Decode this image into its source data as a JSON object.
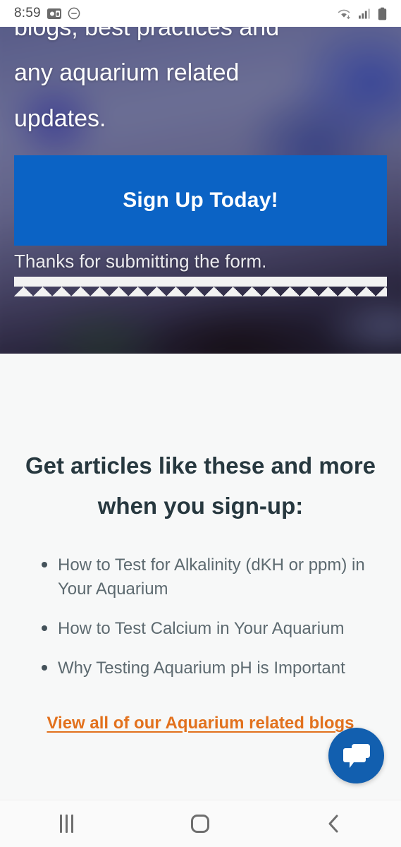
{
  "status_bar": {
    "time": "8:59",
    "left_icons": [
      "screen-record-icon",
      "do-not-disturb-icon"
    ],
    "right_icons": [
      "wifi-icon",
      "cellular-signal-icon",
      "battery-icon"
    ]
  },
  "hero": {
    "paragraph_lines": [
      "blogs, best practices and",
      "any aquarium related",
      "updates."
    ],
    "signup_button_label": "Sign Up Today!",
    "form_status_message": "Thanks for submitting the form.",
    "button_color": "#0B63C5",
    "zigzag_divider_color": "#F2F2F2"
  },
  "main": {
    "heading": "Get articles like these and more when you sign-up:",
    "heading_color": "#27383F",
    "articles": [
      "How to Test for Alkalinity (dKH or ppm) in Your Aquarium",
      "How to Test Calcium in Your Aquarium",
      "Why Testing Aquarium pH is Important"
    ],
    "link_text": "View all of our Aquarium related blogs",
    "link_color": "#E2711D",
    "background_color": "#F7F8F8"
  },
  "chat_widget": {
    "icon": "chat-bubbles-icon",
    "color": "#125FAF"
  },
  "nav_bar": {
    "recents_label": "recents-icon",
    "home_label": "home-icon",
    "back_label": "back-icon"
  }
}
